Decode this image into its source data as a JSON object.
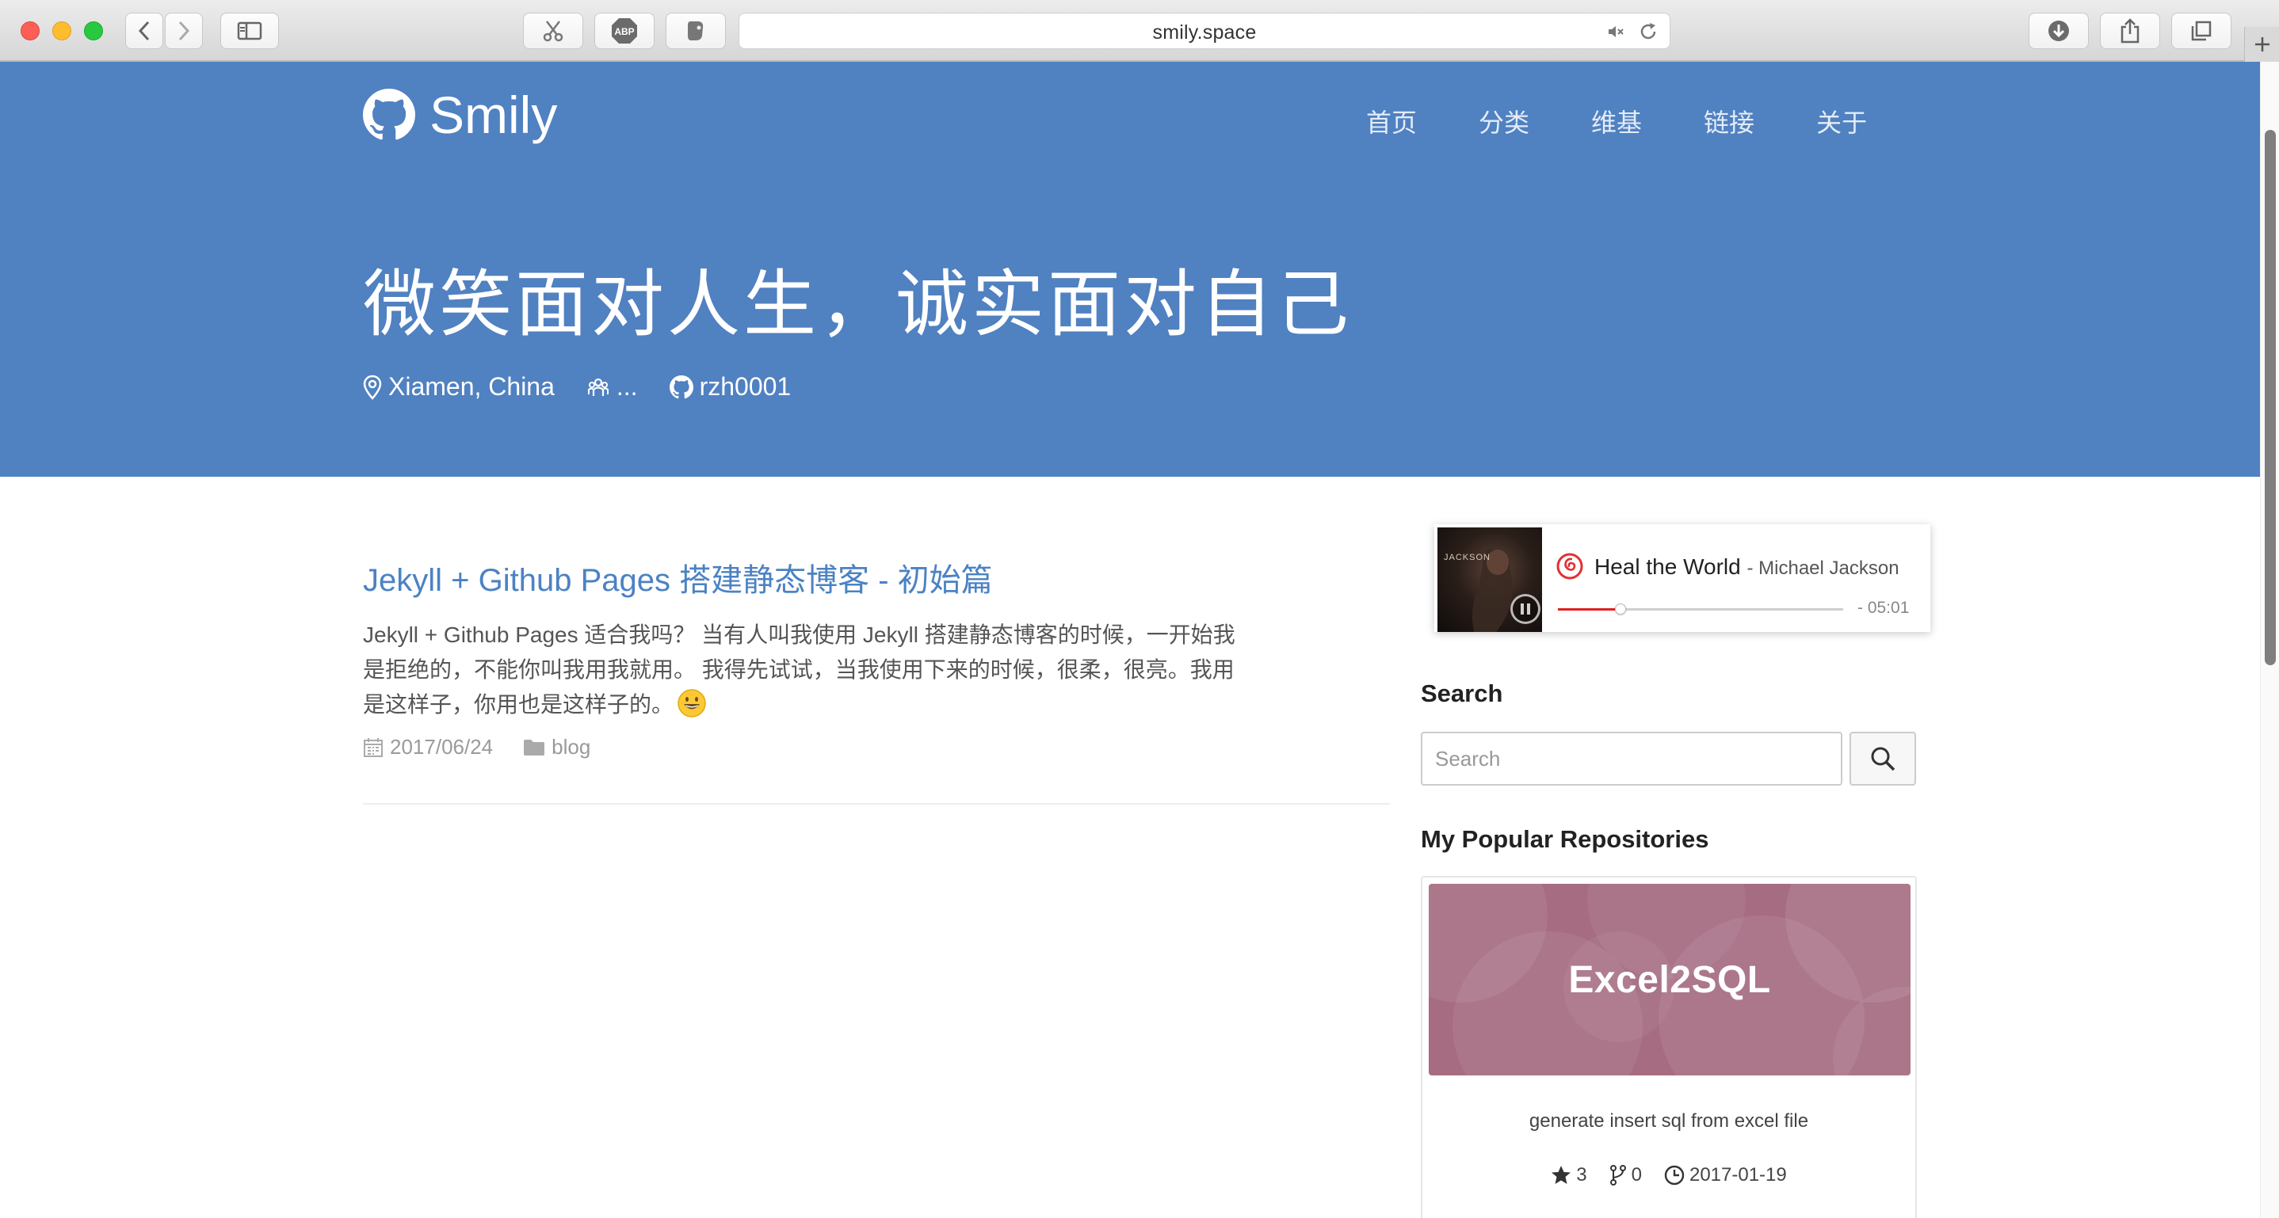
{
  "browser": {
    "url": "smily.space",
    "extension_icons": [
      "scissors-icon",
      "adblock-icon",
      "clipper-icon"
    ]
  },
  "site": {
    "brand": "Smily",
    "nav": [
      "首页",
      "分类",
      "维基",
      "链接",
      "关于"
    ],
    "slogan": "微笑面对人生，诚实面对自己",
    "location": "Xiamen, China",
    "company": "...",
    "github": "rzh0001",
    "accent": "#5081c1"
  },
  "post": {
    "title": "Jekyll + Github Pages 搭建静态博客 - 初始篇",
    "excerpt": "Jekyll + Github Pages 适合我吗？ 当有人叫我使用 Jekyll 搭建静态博客的时候，一开始我是拒绝的，不能你叫我用我就用。 我得先试试，当我使用下来的时候，很柔，很亮。我用是这样子，你用也是这样子的。",
    "date": "2017/06/24",
    "category": "blog"
  },
  "player": {
    "song": "Heal the World",
    "artist": "Michael Jackson",
    "time": "- 05:01",
    "cover_caption": "JACKSON",
    "progress": 0.22
  },
  "sidebar": {
    "search_heading": "Search",
    "search_placeholder": "Search",
    "repos_heading": "My Popular Repositories",
    "repo": {
      "name": "Excel2SQL",
      "description": "generate insert sql from excel file",
      "stars": "3",
      "forks": "0",
      "updated": "2017-01-19",
      "banner_color": "#a56c82"
    }
  }
}
